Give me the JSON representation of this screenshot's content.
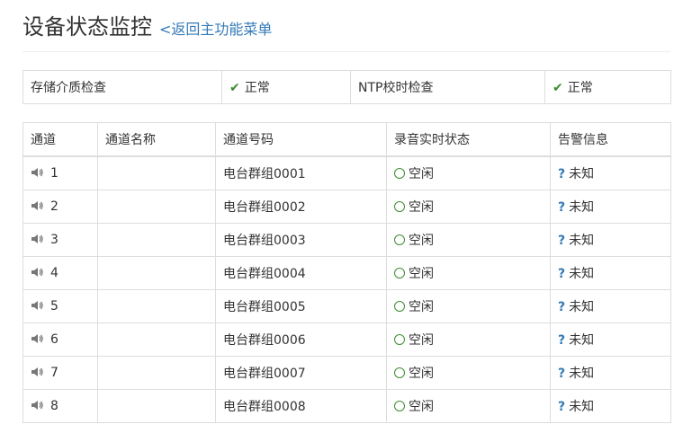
{
  "header": {
    "title": "设备状态监控",
    "back_link": "<返回主功能菜单"
  },
  "status": {
    "media_label": "存储介质检查",
    "media_value": "正常",
    "ntp_label": "NTP校时检查",
    "ntp_value": "正常"
  },
  "table": {
    "columns": [
      "通道",
      "通道名称",
      "通道号码",
      "录音实时状态",
      "告警信息"
    ],
    "rows": [
      {
        "channel": "1",
        "name": "",
        "number": "电台群组0001",
        "state": "空闲",
        "alarm": "未知"
      },
      {
        "channel": "2",
        "name": "",
        "number": "电台群组0002",
        "state": "空闲",
        "alarm": "未知"
      },
      {
        "channel": "3",
        "name": "",
        "number": "电台群组0003",
        "state": "空闲",
        "alarm": "未知"
      },
      {
        "channel": "4",
        "name": "",
        "number": "电台群组0004",
        "state": "空闲",
        "alarm": "未知"
      },
      {
        "channel": "5",
        "name": "",
        "number": "电台群组0005",
        "state": "空闲",
        "alarm": "未知"
      },
      {
        "channel": "6",
        "name": "",
        "number": "电台群组0006",
        "state": "空闲",
        "alarm": "未知"
      },
      {
        "channel": "7",
        "name": "",
        "number": "电台群组0007",
        "state": "空闲",
        "alarm": "未知"
      },
      {
        "channel": "8",
        "name": "",
        "number": "电台群组0008",
        "state": "空闲",
        "alarm": "未知"
      }
    ]
  },
  "icons": {
    "status_ok": "check-icon",
    "channel": "speaker-icon",
    "state_idle": "circle-icon",
    "alarm_unknown": "question-icon"
  },
  "colors": {
    "ok_green": "#3c8d2f",
    "link_blue": "#337ab7",
    "border": "#dddddd"
  }
}
